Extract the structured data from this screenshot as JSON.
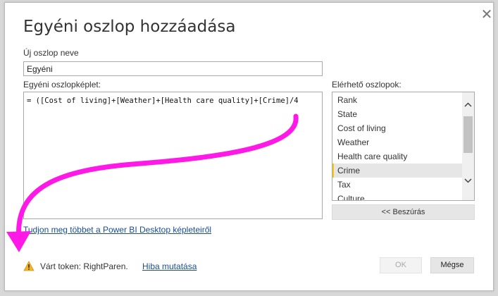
{
  "dialog": {
    "title": "Egyéni oszlop hozzáadása",
    "close_glyph": "✕"
  },
  "name_field": {
    "label": "Új oszlop neve",
    "value": "Egyéni"
  },
  "formula": {
    "label": "Egyéni oszlopképlet:",
    "value": "= ([Cost of living]+[Weather]+[Health care quality]+[Crime]/4"
  },
  "columns": {
    "label": "Elérhető oszlopok:",
    "items": [
      "Rank",
      "State",
      "Cost of living",
      "Weather",
      "Health care quality",
      "Crime",
      "Tax",
      "Culture"
    ],
    "selected": "Crime",
    "insert_label": "<< Beszúrás"
  },
  "learn_link": "Tudjon meg többet a Power BI Desktop képleteiről",
  "status": {
    "icon": "warning-icon",
    "message": "Várt token: RightParen.",
    "show_error": "Hiba mutatása"
  },
  "buttons": {
    "ok": "OK",
    "cancel": "Mégse"
  },
  "colors": {
    "annotation_arrow": "#ff19e6",
    "link": "#1a4d94",
    "selection_accent": "#f2c811",
    "warning": "#f0b429"
  }
}
